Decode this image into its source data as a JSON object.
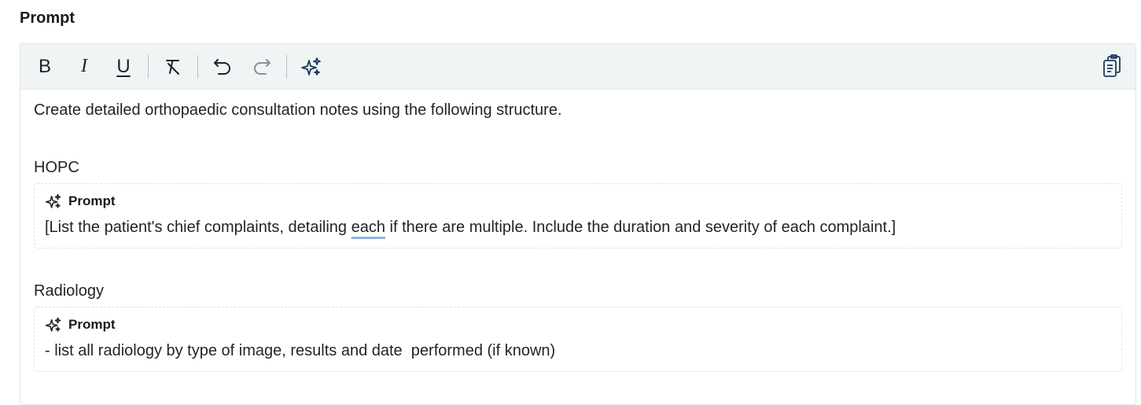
{
  "label": "Prompt",
  "toolbar": {
    "bold": "B",
    "italic": "I",
    "underline": "U"
  },
  "editor": {
    "intro": "Create detailed orthopaedic consultation notes using the following structure.",
    "sections": [
      {
        "heading": "HOPC",
        "prompt_label": "Prompt",
        "text_before": "[List the patient's chief complaints, detailing ",
        "text_flagged": "each",
        "text_after": " if there are multiple. Include the duration and severity of each complaint.]"
      },
      {
        "heading": "Radiology",
        "prompt_label": "Prompt",
        "text": "- list all radiology by type of image, results and date  performed (if known)"
      }
    ]
  },
  "icons": {
    "clear_format": "clear-format-icon",
    "undo": "undo-icon",
    "redo": "redo-icon",
    "ai": "sparkles-icon",
    "copy": "copy-icon"
  },
  "colors": {
    "toolbar_bg": "#f1f4f5",
    "ai_icon": "#1e3a5f",
    "spellcheck_underline": "#8fb4e6"
  }
}
